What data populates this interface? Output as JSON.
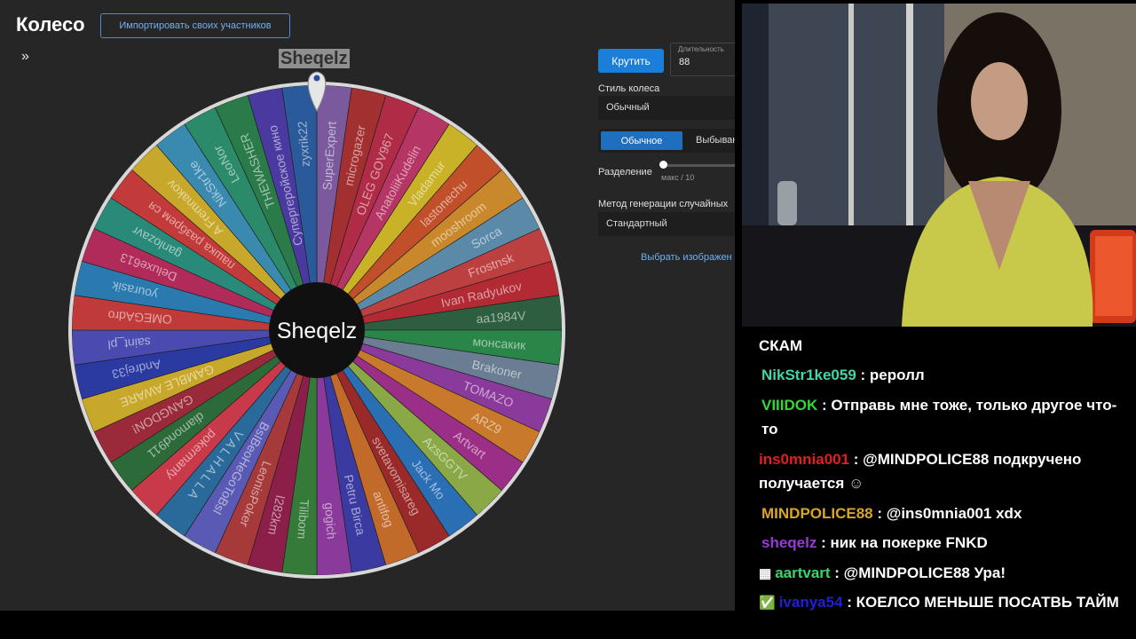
{
  "app": {
    "title": "Колесо",
    "import_button": "Импортировать своих участников",
    "expand_icon": "»",
    "pointer_label": "Sheqelz",
    "center_label": "Sheqelz"
  },
  "controls": {
    "spin_button": "Крутить",
    "duration_label": "Длительность",
    "duration_value": "88",
    "wheel_style_label": "Стиль колеса",
    "wheel_style_value": "Обычный",
    "mode_active": "Обычное",
    "mode_inactive": "Выбыван",
    "separation_label": "Разделение",
    "separation_max": "макс / 10",
    "separation_value": 0,
    "random_method_label": "Метод генерации случайных",
    "random_method_value": "Стандартный",
    "select_image_link": "Выбрать изображен"
  },
  "wheel": {
    "participants": [
      "SuperExpert",
      "microgazer",
      "OLEG GOV967",
      "AnatoliiKudelin",
      "Vladamur",
      "lastonechu",
      "mooshroom",
      "Sorca",
      "Frostnsk",
      "Ivan Radyukov",
      "aa1984V",
      "монсакик",
      "Brakoner",
      "TOMAZO",
      "ARZ9",
      "Artvart",
      "AzsGGTV",
      "Jack Mo",
      "svetavomisareg",
      "antifog",
      "Petru Birca",
      "gogich",
      "Tilibom",
      "l282km",
      "LeonisPoker",
      "BsIBeoHeGoToBsI",
      "V A L H A L L A",
      "pokermanty",
      "diamond911",
      "GANGDON!",
      "GAMBLE AWARE",
      "Andrej33",
      "saint_pl",
      "OMEGAdro",
      "yourasik",
      "Deluxe613",
      "ganlozavr",
      "пашка разбрем ся",
      "A Fremnakov",
      "NikStr1ke",
      "LeoNor",
      "THEWASHER",
      "Супергеройское кино",
      "zyxrik22"
    ],
    "colors": [
      "#7a5a9c",
      "#a33030",
      "#b02b45",
      "#b53564",
      "#c9b227",
      "#c04f2a",
      "#c9882b",
      "#5b8aa8",
      "#bd4040",
      "#b22a33",
      "#2d5e3f",
      "#2a8548",
      "#6a7d92",
      "#8a3a9a",
      "#c9792b",
      "#9b2e86",
      "#8aa846",
      "#2a6eb4",
      "#9a2a2a",
      "#c26a2a",
      "#3a3aa0",
      "#8a3a9a",
      "#357a38",
      "#8c1f4a",
      "#a63a3a",
      "#5a5ab4",
      "#2a6a9a",
      "#c83a4a",
      "#2c6a3a",
      "#9a2a3a",
      "#c8a82a",
      "#2a3aa0",
      "#4a4ab0",
      "#c03a3a",
      "#2a7ab0",
      "#b02a5a",
      "#2a8a7a",
      "#c23a3a",
      "#c8a82a",
      "#3a8ab0",
      "#2a8a6a",
      "#2a7a4a",
      "#4a3aa0",
      "#2a5a9a"
    ]
  },
  "chat": {
    "messages": [
      {
        "user": "",
        "color": "#ffffff",
        "text": "СКАМ",
        "icon": ""
      },
      {
        "user": "NikStr1ke059",
        "color": "#3fd6a8",
        "text": ": реролл",
        "icon": ""
      },
      {
        "user": "VIIIDOK",
        "color": "#33d633",
        "text": ": Отправь мне тоже, только другое что-то",
        "icon": ""
      },
      {
        "user": "ins0mnia001",
        "color": "#e02020",
        "text": ": @MINDPOLICE88 подкручено получается",
        "icon": "face-emote-icon"
      },
      {
        "user": "MINDPOLICE88",
        "color": "#daa520",
        "text": ": @ins0mnia001 xdx",
        "icon": ""
      },
      {
        "user": "sheqelz",
        "color": "#9a3ad6",
        "text": ": ник на покерке FNKD",
        "icon": ""
      },
      {
        "user": "aartvart",
        "color": "#3ad66a",
        "text": ": @MINDPOLICE88 Ура!",
        "icon": "badge-icon"
      },
      {
        "user": "ivanya54",
        "color": "#2020d6",
        "text": ": КОЕЛСО МЕНЬШЕ ПОСАТВЬ ТАЙМ",
        "icon": "check-badge-icon"
      }
    ]
  }
}
